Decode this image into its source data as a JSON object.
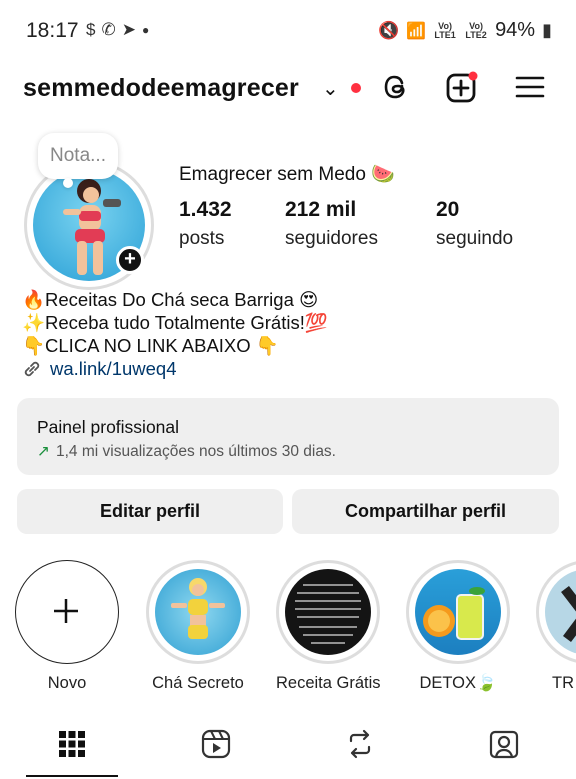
{
  "status_bar": {
    "time": "18:17",
    "network_1": "Vo) LTE1",
    "network_2": "Vo) LTE2",
    "battery": "94%"
  },
  "header": {
    "username": "semmedodeemagrecer",
    "accent": "#ff3040"
  },
  "profile": {
    "note": "Nota...",
    "display_name": "Emagrecer sem Medo 🍉",
    "stats": [
      {
        "value": "1.432",
        "label": "posts"
      },
      {
        "value": "212 mil",
        "label": "seguidores"
      },
      {
        "value": "20",
        "label": "seguindo"
      }
    ],
    "bio": [
      "🔥Receitas Do Chá seca Barriga 😍",
      "✨Receba tudo Totalmente Grátis!💯",
      "👇CLICA NO LINK ABAIXO 👇"
    ],
    "link": "wa.link/1uweq4"
  },
  "pro_panel": {
    "title": "Painel profissional",
    "subtitle": "1,4 mi visualizações nos últimos 30 dias."
  },
  "buttons": {
    "edit": "Editar perfil",
    "share": "Compartilhar perfil"
  },
  "highlights": [
    {
      "label": "Novo",
      "icon": "plus-icon"
    },
    {
      "label": "Chá Secreto"
    },
    {
      "label": "Receita Grátis"
    },
    {
      "label": "DETOX🍃"
    },
    {
      "label": "TR"
    }
  ],
  "tabs": [
    {
      "icon": "grid-icon"
    },
    {
      "icon": "reels-icon"
    },
    {
      "icon": "repost-icon"
    },
    {
      "icon": "tagged-icon"
    }
  ]
}
